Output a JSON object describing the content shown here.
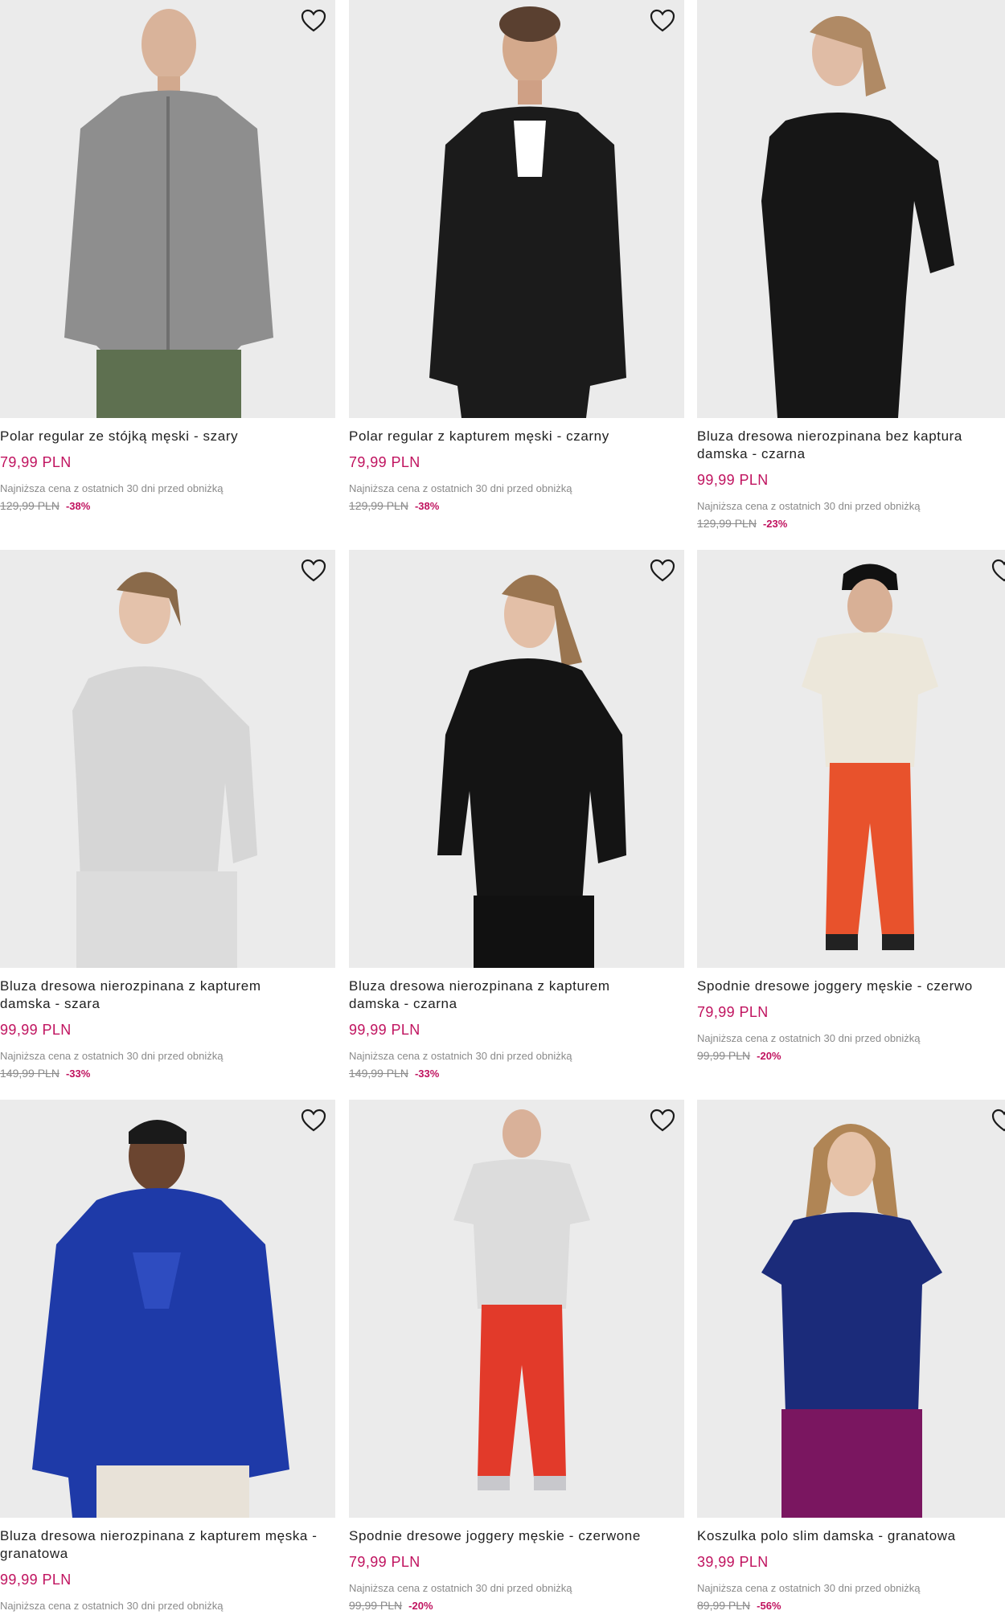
{
  "lowest_label": "Najniższa cena z ostatnich 30 dni przed obniżką",
  "heart_icon": "heart-outline-icon",
  "colors": {
    "price": "#c0135f",
    "image_bg": "#ebebeb",
    "muted": "#8a8a8a"
  },
  "products": [
    {
      "name": "Polar regular ze stójką męski - szary",
      "price": "79,99 PLN",
      "old_price": "129,99 PLN",
      "discount": "-38%"
    },
    {
      "name": "Polar regular z kapturem męski - czarny",
      "price": "79,99 PLN",
      "old_price": "129,99 PLN",
      "discount": "-38%"
    },
    {
      "name": "Bluza dresowa nierozpinana bez kaptura damska - czarna",
      "price": "99,99 PLN",
      "old_price": "129,99 PLN",
      "discount": "-23%"
    },
    {
      "name": "Bluza dresowa nierozpinana z kapturem damska - szara",
      "price": "99,99 PLN",
      "old_price": "149,99 PLN",
      "discount": "-33%"
    },
    {
      "name": "Bluza dresowa nierozpinana z kapturem damska - czarna",
      "price": "99,99 PLN",
      "old_price": "149,99 PLN",
      "discount": "-33%"
    },
    {
      "name": "Spodnie dresowe joggery męskie - czerwo",
      "price": "79,99 PLN",
      "old_price": "99,99 PLN",
      "discount": "-20%"
    },
    {
      "name": "Bluza dresowa nierozpinana z kapturem męska - granatowa",
      "price": "99,99 PLN",
      "old_price": "",
      "discount": ""
    },
    {
      "name": "Spodnie dresowe joggery męskie - czerwone",
      "price": "79,99 PLN",
      "old_price": "99,99 PLN",
      "discount": "-20%"
    },
    {
      "name": "Koszulka polo slim damska - granatowa",
      "price": "39,99 PLN",
      "old_price": "89,99 PLN",
      "discount": "-56%"
    }
  ]
}
